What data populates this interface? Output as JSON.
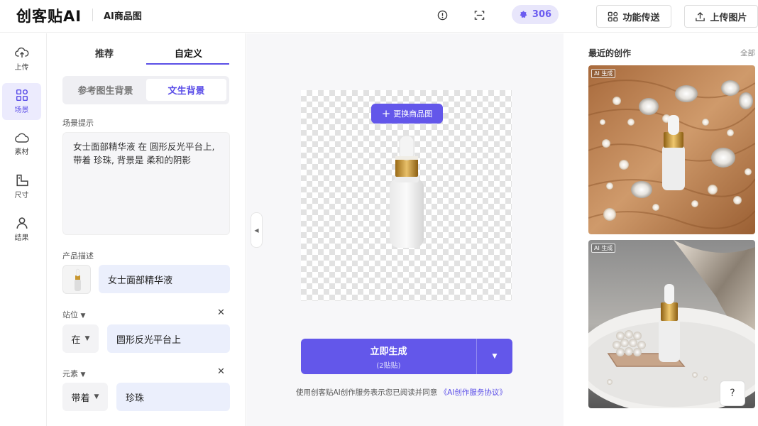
{
  "header": {
    "logo": "创客贴AI",
    "subtitle": "AI商品图",
    "credits": "306",
    "feature_button": "功能传送",
    "upload_button": "上传图片"
  },
  "sidebar": {
    "items": [
      {
        "label": "上传",
        "icon": "upload-cloud-icon"
      },
      {
        "label": "场景",
        "icon": "grid-icon"
      },
      {
        "label": "素材",
        "icon": "cloud-icon"
      },
      {
        "label": "尺寸",
        "icon": "size-icon"
      },
      {
        "label": "结果",
        "icon": "user-icon"
      }
    ]
  },
  "panel": {
    "tabs": [
      "推荐",
      "自定义"
    ],
    "segments": [
      "参考图生背景",
      "文生背景"
    ],
    "scene_label": "场景提示",
    "scene_prompt": "女士面部精华液 在 圆形反光平台上, 带着 珍珠, 背景是 柔和的阴影",
    "product_label": "产品描述",
    "product_value": "女士面部精华液",
    "position_label": "站位",
    "position_select": "在",
    "position_value": "圆形反光平台上",
    "element_label": "元素",
    "element_select": "带着",
    "element_value": "珍珠"
  },
  "canvas": {
    "replace_button": "更换商品图",
    "generate_title": "立即生成",
    "generate_sub": "(2贴贴)",
    "terms_text": "使用创客贴AI创作服务表示您已阅读并同意",
    "terms_link": "《AI创作服务协议》"
  },
  "recent": {
    "title": "最近的创作",
    "all_link": "全部",
    "ai_tag": "AI 生成",
    "help": "?"
  },
  "colors": {
    "accent": "#6357ea",
    "accent_light": "#ecebfd",
    "field_bg": "#ebeffc"
  }
}
